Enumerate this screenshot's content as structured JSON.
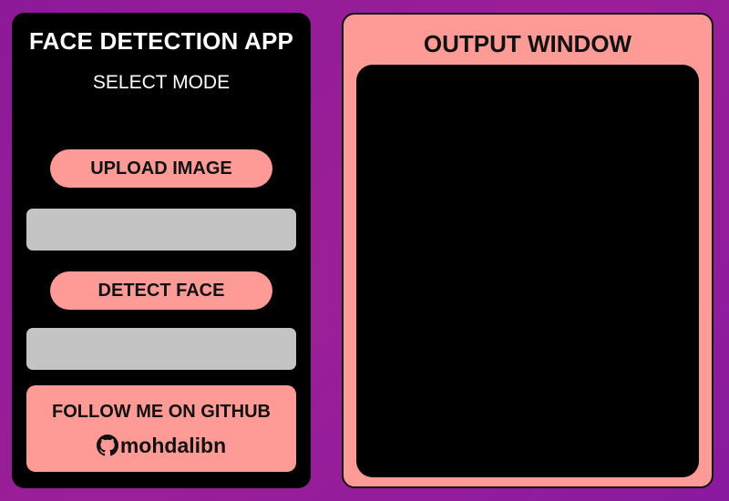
{
  "left_panel": {
    "app_title": "FACE DETECTION APP",
    "mode_label": "SELECT MODE",
    "upload_button_label": "UPLOAD IMAGE",
    "upload_field_value": "",
    "detect_button_label": "DETECT FACE",
    "detect_field_value": "",
    "github": {
      "follow_text": "FOLLOW ME ON GITHUB",
      "icon": "github-icon",
      "handle": "mohdalibn"
    }
  },
  "right_panel": {
    "title": "OUTPUT WINDOW"
  },
  "colors": {
    "background_start": "#8e1a99",
    "panel_dark": "#000000",
    "accent_salmon": "#ff9b96",
    "field_gray": "#c4c4c4",
    "text_light": "#ffffff",
    "text_dark": "#111111"
  }
}
